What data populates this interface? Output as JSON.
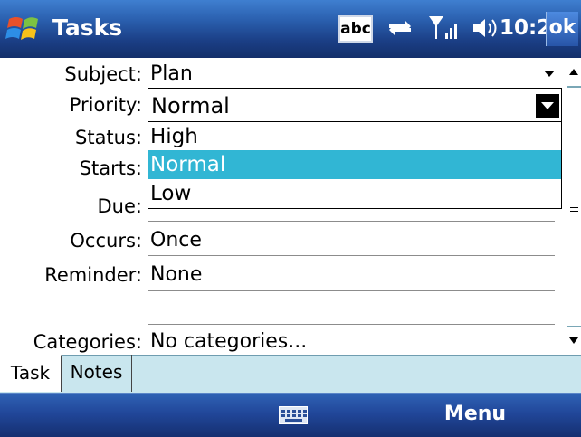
{
  "titlebar": {
    "title": "Tasks",
    "input_mode": "abc",
    "time": "10:21",
    "ok_label": "ok"
  },
  "form": {
    "subject": {
      "label": "Subject:",
      "value": "Plan"
    },
    "priority": {
      "label": "Priority:",
      "value": "Normal"
    },
    "status": {
      "label": "Status:"
    },
    "starts": {
      "label": "Starts:"
    },
    "due": {
      "label": "Due:"
    },
    "occurs": {
      "label": "Occurs:",
      "value": "Once"
    },
    "reminder": {
      "label": "Reminder:",
      "value": "None"
    },
    "categories": {
      "label": "Categories:",
      "value": "No categories..."
    }
  },
  "priority_dropdown": {
    "options": [
      "High",
      "Normal",
      "Low"
    ],
    "selected": "Normal"
  },
  "tabs": [
    {
      "label": "Task",
      "active": true
    },
    {
      "label": "Notes",
      "active": false
    }
  ],
  "menubar": {
    "menu_label": "Menu"
  },
  "colors": {
    "titlebar": "#2a5fae",
    "selection": "#31b6d4",
    "tabbar": "#c9e6ee"
  }
}
